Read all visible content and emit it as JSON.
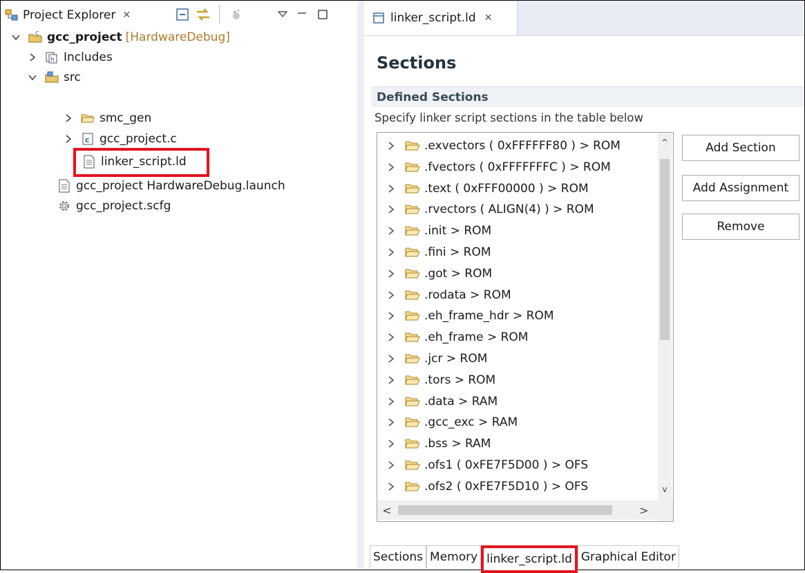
{
  "project_explorer": {
    "tab_label": "Project Explorer",
    "tree": {
      "project_name": "gcc_project",
      "project_config": "[HardwareDebug]",
      "includes_label": "Includes",
      "src_label": "src",
      "smc_gen_label": "smc_gen",
      "source_file_label": "gcc_project.c",
      "linker_file_label": "linker_script.ld",
      "launch_file_label": "gcc_project HardwareDebug.launch",
      "scfg_file_label": "gcc_project.scfg"
    }
  },
  "editor": {
    "tab_label": "linker_script.ld",
    "heading": "Sections",
    "defined_sections_label": "Defined Sections",
    "description": "Specify linker script sections in the table below",
    "sections": [
      ".exvectors ( 0xFFFFFF80 ) > ROM",
      ".fvectors ( 0xFFFFFFFC ) > ROM",
      ".text ( 0xFFF00000 ) > ROM",
      ".rvectors ( ALIGN(4) ) > ROM",
      ".init > ROM",
      ".fini > ROM",
      ".got > ROM",
      ".rodata > ROM",
      ".eh_frame_hdr > ROM",
      ".eh_frame > ROM",
      ".jcr > ROM",
      ".tors > ROM",
      ".data > RAM",
      ".gcc_exc > RAM",
      ".bss > RAM",
      ".ofs1 ( 0xFE7F5D00 ) > OFS",
      ".ofs2 ( 0xFE7F5D10 ) > OFS"
    ],
    "buttons": {
      "add_section": "Add Section",
      "add_assignment": "Add Assignment",
      "remove": "Remove"
    },
    "bottom_tabs": {
      "sections": "Sections",
      "memory": "Memory",
      "linker_script": "linker_script.ld",
      "graphical_editor": "Graphical Editor"
    }
  },
  "colors": {
    "highlight": "#e3141e",
    "config_text": "#b07a2a"
  }
}
